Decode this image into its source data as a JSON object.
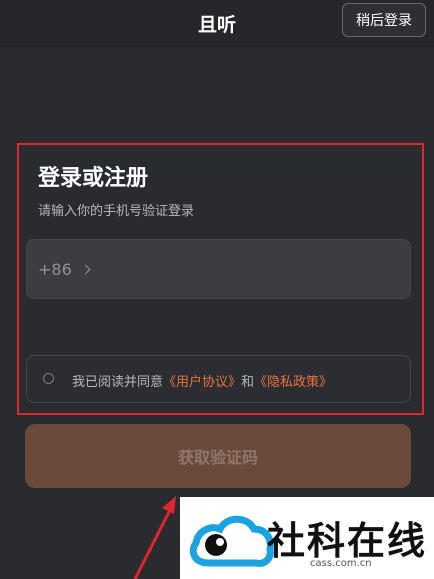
{
  "header": {
    "title": "且听",
    "later_label": "稍后登录"
  },
  "login": {
    "title": "登录或注册",
    "subtitle": "请输入你的手机号验证登录",
    "country_code": "+86",
    "phone_value": "",
    "agreement": {
      "prefix": "我已阅读并同意",
      "user_agreement": "《用户协议》",
      "conjunction": "和",
      "privacy_policy": "《隐私政策》",
      "checked": false
    },
    "get_code_label": "获取验证码"
  },
  "annotation": {
    "highlight_color": "#e0262b"
  },
  "watermark": {
    "text": "社科在线",
    "url": "cass.com.cn"
  },
  "colors": {
    "background": "#2a2b2f",
    "accent": "#e8733c",
    "button_disabled": "#6b4a3c"
  }
}
